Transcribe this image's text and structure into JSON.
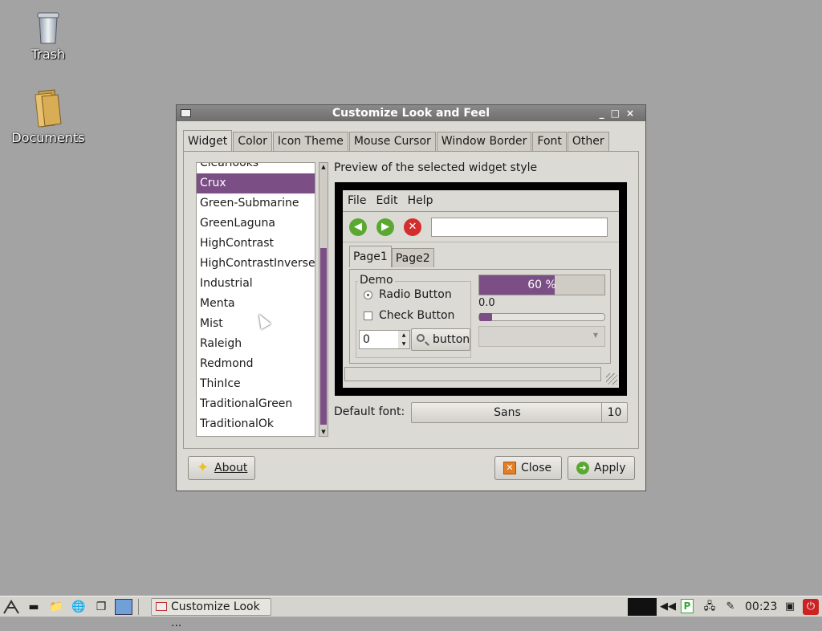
{
  "desktop": {
    "icons": [
      {
        "label": "Trash",
        "icon": "trash-icon"
      },
      {
        "label": "Documents",
        "icon": "folder-icon"
      }
    ]
  },
  "window": {
    "title": "Customize Look and Feel",
    "controls": [
      "_",
      "□",
      "×"
    ],
    "tabs": [
      "Widget",
      "Color",
      "Icon Theme",
      "Mouse Cursor",
      "Window Border",
      "Font",
      "Other"
    ],
    "active_tab": "Widget",
    "themes": [
      "Clearlooks",
      "Crux",
      "Green-Submarine",
      "GreenLaguna",
      "HighContrast",
      "HighContrastInverse",
      "Industrial",
      "Menta",
      "Mist",
      "Raleigh",
      "Redmond",
      "ThinIce",
      "TraditionalGreen",
      "TraditionalOk"
    ],
    "selected_theme": "Crux",
    "preview_label": "Preview of the selected widget style",
    "preview": {
      "menu": [
        "File",
        "Edit",
        "Help"
      ],
      "tabs": [
        "Page1",
        "Page2"
      ],
      "demo_label": "Demo",
      "radio_label": "Radio Button",
      "check_label": "Check Button",
      "spin_value": "0",
      "button_label": "button",
      "progress_text": "60 %",
      "progress_fraction": 0.6,
      "scale_value": "0.0"
    },
    "default_font_label": "Default font:",
    "font_name": "Sans",
    "font_size": "10",
    "buttons": {
      "about": "About",
      "close": "Close",
      "apply": "Apply"
    }
  },
  "taskbar": {
    "task_label": "Customize Look ...",
    "clock": "00:23"
  },
  "colors": {
    "accent": "#7b4f85",
    "desktop": "#a3a3a3",
    "window_bg": "#dcdad5"
  }
}
